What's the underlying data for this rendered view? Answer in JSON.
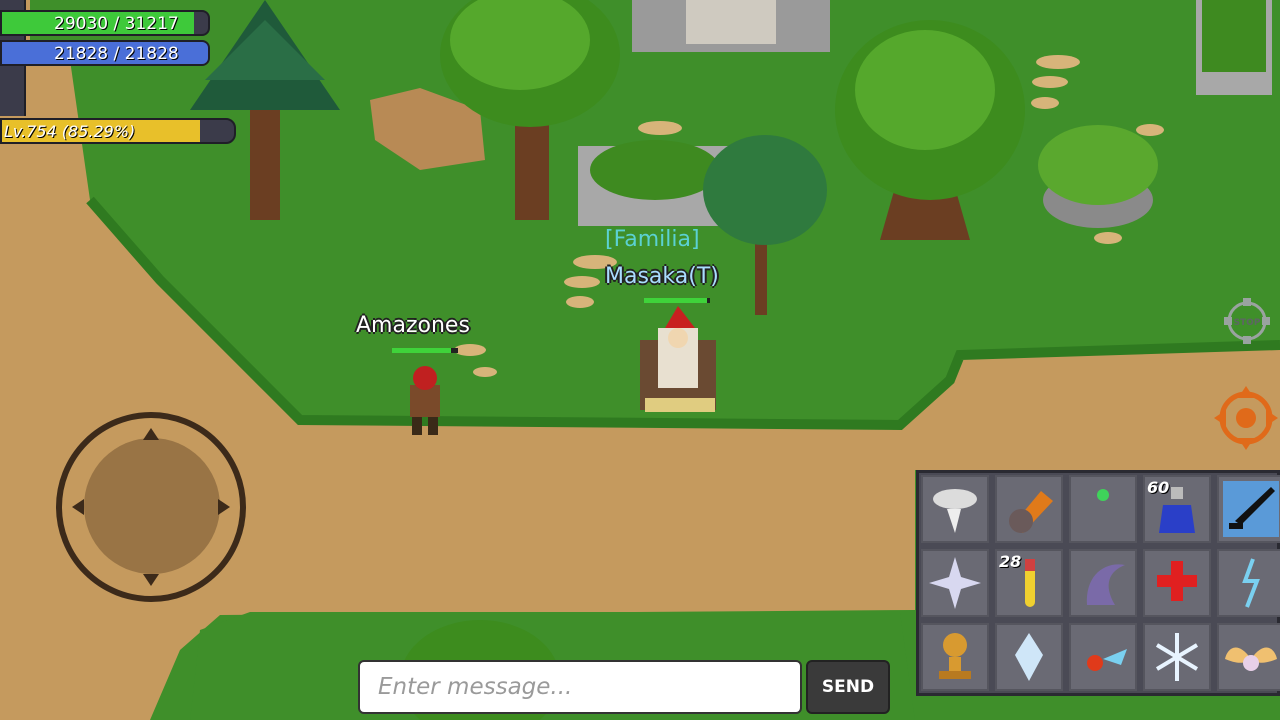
{
  "hud": {
    "hp_text": "29030 / 31217",
    "hp_fraction": 0.93,
    "mp_text": "21828 / 21828",
    "mp_fraction": 1.0,
    "level_text": "Lv.754 (85.29%)",
    "xp_fraction": 0.8529,
    "colors": {
      "hp": "#3ec93a",
      "mp": "#4a6fd8",
      "xp": "#e8c02a"
    }
  },
  "player": {
    "guild_tag": "[Familia]",
    "name": "Masaka(T)",
    "hp_fraction": 0.95
  },
  "npc": {
    "name": "Amazones",
    "hp_fraction": 0.9
  },
  "controls": {
    "stop_label": "STOP",
    "joystick_icon": "dpad-joystick-icon",
    "target_icon": "target-crosshair-icon"
  },
  "skillbar": {
    "slots": [
      {
        "icon": "whirlwind-skill-icon",
        "count": ""
      },
      {
        "icon": "meteor-skill-icon",
        "count": ""
      },
      {
        "icon": "green-sprite-icon",
        "count": ""
      },
      {
        "icon": "blue-potion-icon",
        "count": "60"
      },
      {
        "icon": "sword-skill-icon",
        "count": ""
      },
      {
        "icon": "crystal-star-skill-icon",
        "count": ""
      },
      {
        "icon": "yellow-potion-icon",
        "count": "28"
      },
      {
        "icon": "purple-claw-skill-icon",
        "count": ""
      },
      {
        "icon": "heal-cross-skill-icon",
        "count": ""
      },
      {
        "icon": "lightning-skill-icon",
        "count": ""
      },
      {
        "icon": "golden-trophy-skill-icon",
        "count": ""
      },
      {
        "icon": "ice-crystal-skill-icon",
        "count": ""
      },
      {
        "icon": "fireball-skill-icon",
        "count": ""
      },
      {
        "icon": "snowflake-skill-icon",
        "count": ""
      },
      {
        "icon": "angel-wings-skill-icon",
        "count": ""
      }
    ]
  },
  "chat": {
    "placeholder": "Enter message...",
    "send_label": "SEND"
  }
}
